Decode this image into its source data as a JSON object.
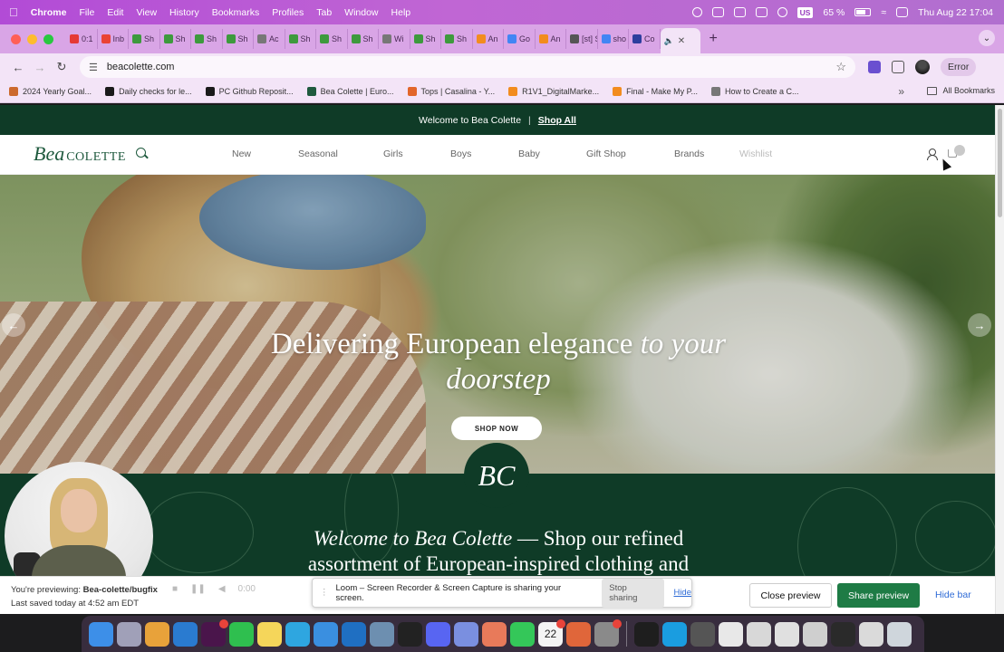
{
  "menubar": {
    "app_name": "Chrome",
    "items": [
      "File",
      "Edit",
      "View",
      "History",
      "Bookmarks",
      "Profiles",
      "Tab",
      "Window",
      "Help"
    ],
    "input_lang": "US",
    "battery": "65 %",
    "datetime": "Thu Aug 22  17:04"
  },
  "tabs": [
    {
      "label": "0:1",
      "color": "#e53935"
    },
    {
      "label": "Inb",
      "color": "#ea4335"
    },
    {
      "label": "Sh",
      "color": "#3d9a3d"
    },
    {
      "label": "Sh",
      "color": "#3d9a3d"
    },
    {
      "label": "Sh",
      "color": "#3d9a3d"
    },
    {
      "label": "Sh",
      "color": "#3d9a3d"
    },
    {
      "label": "Ac",
      "color": "#777777"
    },
    {
      "label": "Sh",
      "color": "#3d9a3d"
    },
    {
      "label": "Sh",
      "color": "#3d9a3d"
    },
    {
      "label": "Sh",
      "color": "#3d9a3d"
    },
    {
      "label": "Wi",
      "color": "#777777"
    },
    {
      "label": "Sh",
      "color": "#3d9a3d"
    },
    {
      "label": "Sh",
      "color": "#3d9a3d"
    },
    {
      "label": "An",
      "color": "#f28c1e"
    },
    {
      "label": "Go",
      "color": "#4285f4"
    },
    {
      "label": "An",
      "color": "#f28c1e"
    },
    {
      "label": "[st] Sto",
      "color": "#555555"
    },
    {
      "label": "sho",
      "color": "#4285f4"
    },
    {
      "label": "Co",
      "color": "#2d3e9e"
    }
  ],
  "toolbar": {
    "url": "beacolette.com",
    "error_label": "Error"
  },
  "bookmarks": [
    {
      "label": "2024 Yearly Goal...",
      "color": "#cc6a2e"
    },
    {
      "label": "Daily checks for le...",
      "color": "#1a1a1a"
    },
    {
      "label": "PC Github Reposit...",
      "color": "#1a1a1a"
    },
    {
      "label": "Bea Colette | Euro...",
      "color": "#1f5a3e"
    },
    {
      "label": "Tops | Casalina - Y...",
      "color": "#e2662a"
    },
    {
      "label": "R1V1_DigitalMarke...",
      "color": "#f28c1e"
    },
    {
      "label": "Final - Make My P...",
      "color": "#f28c1e"
    },
    {
      "label": "How to Create a C...",
      "color": "#777777"
    }
  ],
  "all_bookmarks": "All Bookmarks",
  "site": {
    "promo_text": "Welcome to Bea Colette",
    "promo_link": "Shop All",
    "logo_bea": "Bea",
    "logo_colette": "COLETTE",
    "nav": [
      "New",
      "Seasonal",
      "Girls",
      "Boys",
      "Baby",
      "Gift Shop",
      "Brands",
      "Wishlist"
    ],
    "hero_title_plain": "Delivering European elegance",
    "hero_title_italic_1": "to your",
    "hero_title_italic_2": "doorstep",
    "hero_cta": "SHOP NOW",
    "monogram": "BC",
    "welcome_italic": "Welcome to Bea Colette",
    "welcome_rest": "— Shop our refined assortment of European-inspired clothing and"
  },
  "preview_bar": {
    "previewing_label": "You're previewing:",
    "branch": "Bea-colette/bugfix",
    "saved": "Last saved today at 4:52 am EDT",
    "close_label": "Close preview",
    "share_label": "Share preview",
    "hide_label": "Hide bar"
  },
  "loom": {
    "message": "Loom – Screen Recorder & Screen Capture is sharing your screen.",
    "stop_label": "Stop sharing",
    "hide_label": "Hide",
    "time": "0:00"
  },
  "dock": {
    "apps": [
      {
        "name": "finder",
        "color": "#3d8fe8"
      },
      {
        "name": "launchpad",
        "color": "#a0a0b8"
      },
      {
        "name": "chrome",
        "color": "#e8a23a"
      },
      {
        "name": "vscode",
        "color": "#2a7bd0"
      },
      {
        "name": "slack",
        "color": "#4a154b"
      },
      {
        "name": "whatsapp",
        "color": "#2fbf4f"
      },
      {
        "name": "notes",
        "color": "#f5d65a"
      },
      {
        "name": "telegram",
        "color": "#2ea6e0"
      },
      {
        "name": "safari",
        "color": "#3a8fe0"
      },
      {
        "name": "trello",
        "color": "#1f6fc2"
      },
      {
        "name": "preview",
        "color": "#6d8fb0"
      },
      {
        "name": "terminal",
        "color": "#222222"
      },
      {
        "name": "discord",
        "color": "#5865f2"
      },
      {
        "name": "app-store",
        "color": "#7a8fe0"
      },
      {
        "name": "photos",
        "color": "#e87a5a"
      },
      {
        "name": "facetime",
        "color": "#34c759"
      },
      {
        "name": "calendar",
        "color": "#f4f4f4"
      },
      {
        "name": "firefox",
        "color": "#e0663a"
      },
      {
        "name": "settings",
        "color": "#8a8a8a"
      },
      {
        "name": "terminal-2",
        "color": "#1e1e1e"
      },
      {
        "name": "skype",
        "color": "#1a9de0"
      },
      {
        "name": "calculator",
        "color": "#555555"
      },
      {
        "name": "document",
        "color": "#e8e8e8"
      },
      {
        "name": "window-1",
        "color": "#d8d8d8"
      },
      {
        "name": "window-2",
        "color": "#e0e0e0"
      },
      {
        "name": "window-3",
        "color": "#cfcfcf"
      },
      {
        "name": "window-4",
        "color": "#2a2a2a"
      },
      {
        "name": "window-5",
        "color": "#dadada"
      },
      {
        "name": "trash",
        "color": "#cfd6dc"
      }
    ],
    "calendar_day": "22"
  }
}
